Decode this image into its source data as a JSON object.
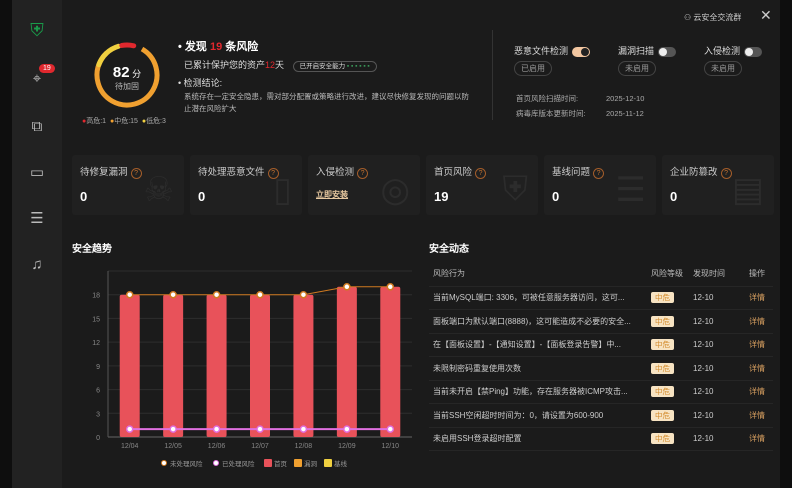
{
  "sidebar": {
    "badge": "19",
    "items": [
      "logo",
      "risk-scan",
      "file-search",
      "monitor",
      "server-shield",
      "alerts"
    ]
  },
  "header": {
    "community_link": "云安全交流群"
  },
  "score": {
    "value": "82",
    "unit": "分",
    "status": "待加固",
    "legend": [
      "高危:1",
      "中危:15",
      "低危:3"
    ],
    "colors": {
      "high": "#e0282e",
      "mid": "#f0a030",
      "low": "#f0d040"
    }
  },
  "summary": {
    "found_prefix": "发现",
    "found_count": "19",
    "found_suffix": "条风险",
    "protect_prefix": "已累计保护您的资产",
    "protect_days": "12",
    "protect_suffix": "天",
    "capability_label": "已开启安全能力",
    "conclusion_title": "检测结论:",
    "conclusion_text": "系统存在一定安全隐患，需对部分配置或策略进行改进，建议尽快修复发现的问题以防止潜在风险扩大"
  },
  "toggles": [
    {
      "label": "恶意文件检测",
      "state": "已启用",
      "on": true
    },
    {
      "label": "漏洞扫描",
      "state": "未启用",
      "on": false
    },
    {
      "label": "入侵检测",
      "state": "未启用",
      "on": false
    }
  ],
  "times": [
    {
      "label": "首页风险扫描时间:",
      "value": "2025-12-10"
    },
    {
      "label": "病毒库版本更新时间:",
      "value": "2025-11-12"
    }
  ],
  "cards": [
    {
      "title": "待修复漏洞",
      "value": "0"
    },
    {
      "title": "待处理恶意文件",
      "value": "0"
    },
    {
      "title": "入侵检测",
      "value": "立即安装"
    },
    {
      "title": "首页风险",
      "value": "19"
    },
    {
      "title": "基线问题",
      "value": "0"
    },
    {
      "title": "企业防篡改",
      "value": "0"
    }
  ],
  "trend_title": "安全趋势",
  "chart_data": {
    "type": "bar",
    "categories": [
      "12/04",
      "12/05",
      "12/06",
      "12/07",
      "12/08",
      "12/09",
      "12/10"
    ],
    "ylim": [
      0,
      21
    ],
    "yticks": [
      "0",
      "3",
      "6",
      "9",
      "12",
      "15",
      "18"
    ],
    "series": [
      {
        "name": "未处理风险",
        "kind": "line",
        "values": [
          18,
          18,
          18,
          18,
          18,
          19,
          19
        ],
        "color": "#d07a20"
      },
      {
        "name": "已处理风险",
        "kind": "line",
        "values": [
          1,
          1,
          1,
          1,
          1,
          1,
          1
        ],
        "color": "#e070e0"
      },
      {
        "name": "首页",
        "kind": "bar",
        "values": [
          18,
          18,
          18,
          18,
          18,
          19,
          19
        ],
        "color": "#e8525a"
      },
      {
        "name": "漏洞",
        "kind": "bar",
        "values": [
          0,
          0,
          0,
          0,
          0,
          0,
          0
        ],
        "color": "#f0a030"
      },
      {
        "name": "基线",
        "kind": "bar",
        "values": [
          0,
          0,
          0,
          0,
          0,
          0,
          0
        ],
        "color": "#f0d040"
      }
    ]
  },
  "dynamics": {
    "title": "安全动态",
    "columns": [
      "风险行为",
      "风险等级",
      "发现时间",
      "操作"
    ],
    "rows": [
      {
        "desc": "当前MySQL端口: 3306，可被任意服务器访问，这可...",
        "level": "中危",
        "time": "12-10",
        "action": "详情"
      },
      {
        "desc": "面板端口为默认端口(8888)，这可能造成不必要的安全...",
        "level": "中危",
        "time": "12-10",
        "action": "详情"
      },
      {
        "desc": "在【面板设置】-【通知设置】-【面板登录告警】中...",
        "level": "中危",
        "time": "12-10",
        "action": "详情"
      },
      {
        "desc": "未限制密码重复使用次数",
        "level": "中危",
        "time": "12-10",
        "action": "详情"
      },
      {
        "desc": "当前未开启【禁Ping】功能，存在服务器被ICMP攻击...",
        "level": "中危",
        "time": "12-10",
        "action": "详情"
      },
      {
        "desc": "当前SSH空闲超时时间为：0，请设置为600-900",
        "level": "中危",
        "time": "12-10",
        "action": "详情"
      },
      {
        "desc": "未启用SSH登录超时配置",
        "level": "中危",
        "time": "12-10",
        "action": "详情"
      }
    ]
  }
}
